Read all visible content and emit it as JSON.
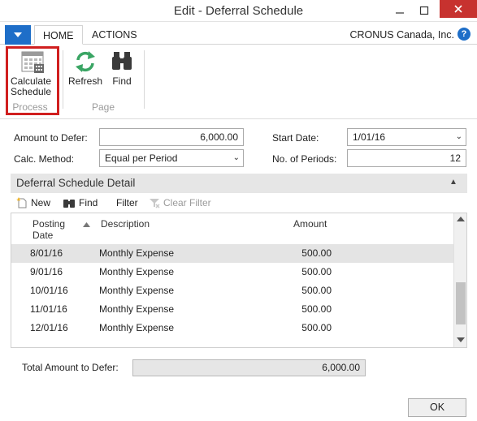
{
  "window": {
    "title": "Edit - Deferral Schedule"
  },
  "ribbon": {
    "tabs": [
      {
        "label": "HOME"
      },
      {
        "label": "ACTIONS"
      }
    ],
    "company": "CRONUS Canada, Inc.",
    "help_label": "?",
    "groups": [
      {
        "label": "Process",
        "buttons": [
          {
            "label_line1": "Calculate",
            "label_line2": "Schedule",
            "icon": "calendar-icon"
          }
        ]
      },
      {
        "label": "Page",
        "buttons": [
          {
            "label": "Refresh",
            "icon": "refresh-icon"
          },
          {
            "label": "Find",
            "icon": "binoculars-icon"
          }
        ]
      }
    ]
  },
  "form": {
    "amount_to_defer": {
      "label": "Amount to Defer:",
      "value": "6,000.00"
    },
    "calc_method": {
      "label": "Calc. Method:",
      "value": "Equal per Period"
    },
    "start_date": {
      "label": "Start Date:",
      "value": "1/01/16"
    },
    "no_of_periods": {
      "label": "No. of Periods:",
      "value": "12"
    }
  },
  "detail": {
    "title": "Deferral Schedule Detail",
    "toolbar": {
      "new": "New",
      "find": "Find",
      "filter": "Filter",
      "clear_filter": "Clear Filter"
    },
    "columns": {
      "posting_date_line1": "Posting",
      "posting_date_line2": "Date",
      "description": "Description",
      "amount": "Amount"
    },
    "rows": [
      {
        "date": "8/01/16",
        "description": "Monthly Expense",
        "amount": "500.00",
        "selected": true
      },
      {
        "date": "9/01/16",
        "description": "Monthly Expense",
        "amount": "500.00"
      },
      {
        "date": "10/01/16",
        "description": "Monthly Expense",
        "amount": "500.00"
      },
      {
        "date": "11/01/16",
        "description": "Monthly Expense",
        "amount": "500.00"
      },
      {
        "date": "12/01/16",
        "description": "Monthly Expense",
        "amount": "500.00"
      }
    ]
  },
  "total": {
    "label": "Total Amount to Defer:",
    "value": "6,000.00"
  },
  "ok_label": "OK",
  "colors": {
    "accent": "#1e6ec8",
    "highlight": "#d01f1f",
    "close": "#c7322f"
  }
}
